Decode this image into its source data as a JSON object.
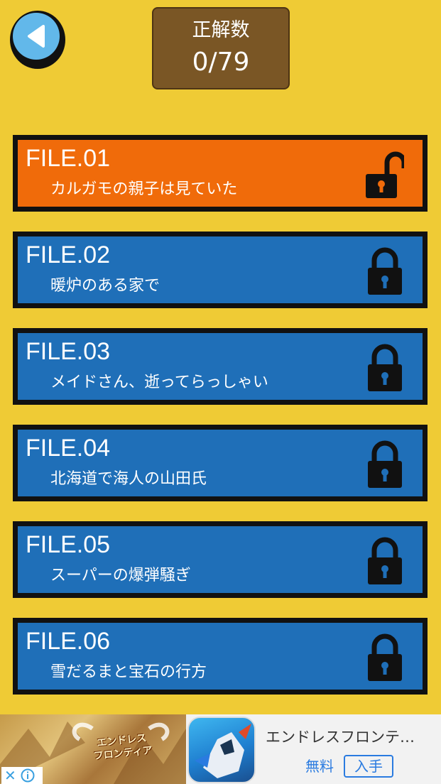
{
  "header": {
    "back_icon": "triangle-left-icon",
    "score_label": "正解数",
    "score_value": "0/79"
  },
  "files": [
    {
      "number": "FILE.01",
      "title": "カルガモの親子は見ていた",
      "locked": false
    },
    {
      "number": "FILE.02",
      "title": "暖炉のある家で",
      "locked": true
    },
    {
      "number": "FILE.03",
      "title": "メイドさん、逝ってらっしゃい",
      "locked": true
    },
    {
      "number": "FILE.04",
      "title": "北海道で海人の山田氏",
      "locked": true
    },
    {
      "number": "FILE.05",
      "title": "スーパーの爆弾騒ぎ",
      "locked": true
    },
    {
      "number": "FILE.06",
      "title": "雪だるまと宝石の行方",
      "locked": true
    }
  ],
  "ad": {
    "banner_logo": "エンドレス\nフロンティア",
    "title": "エンドレスフロンテ…",
    "price": "無料",
    "get_label": "入手",
    "close_icon": "close-icon",
    "info_icon": "info-icon"
  },
  "colors": {
    "background": "#efcb35",
    "unlocked": "#f06b0a",
    "locked": "#1f6fb8",
    "score_box": "#7a5625",
    "back_button": "#62b8ea"
  }
}
